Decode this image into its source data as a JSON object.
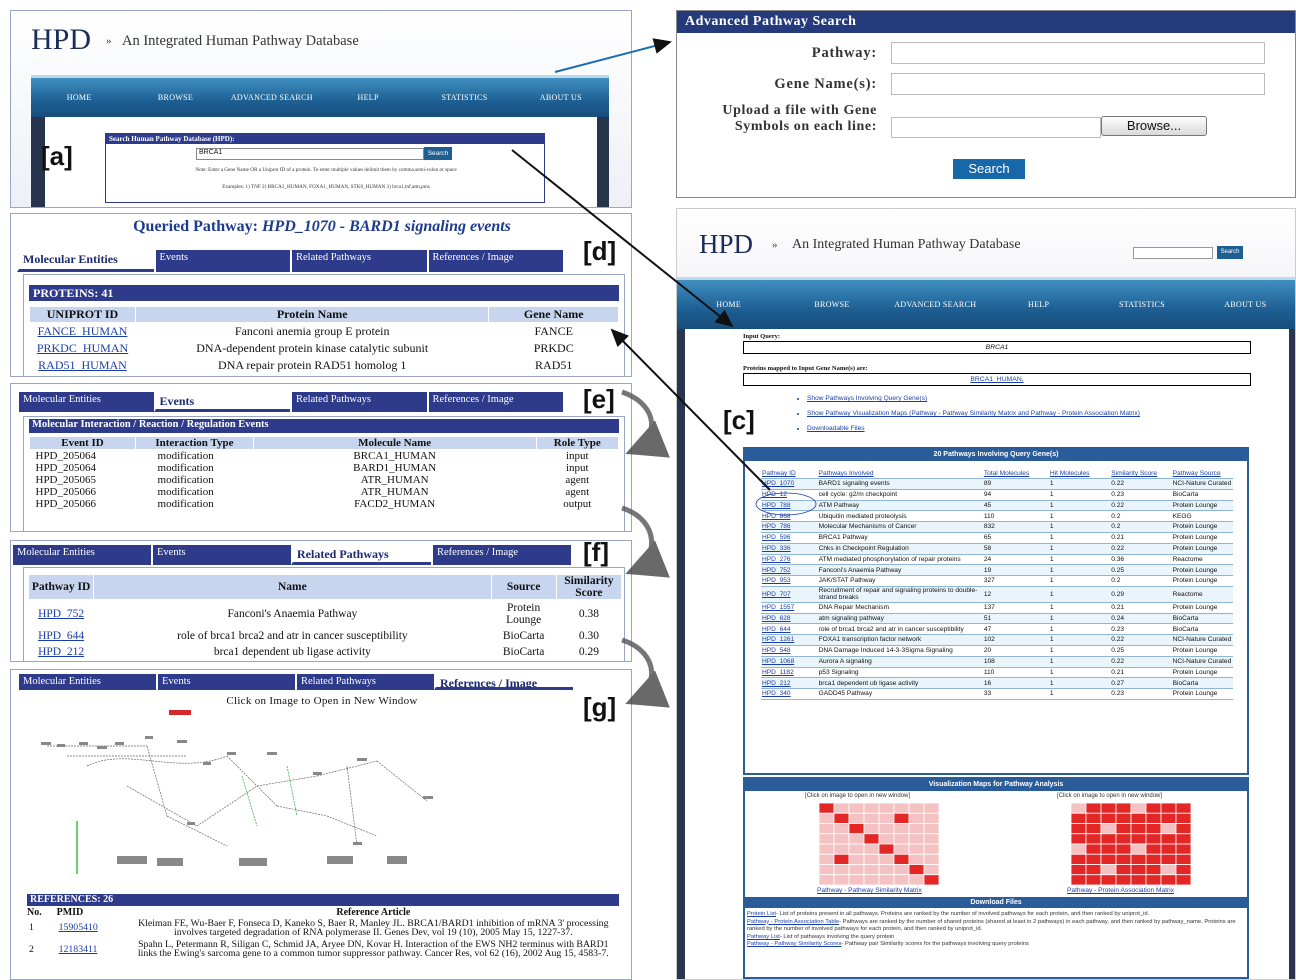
{
  "panel_a": {
    "brand": "HPD",
    "sep": "»",
    "subtitle": "An Integrated Human Pathway Database",
    "nav": [
      "HOME",
      "BROWSE",
      "ADVANCED SEARCH",
      "HELP",
      "STATISTICS",
      "ABOUT US"
    ],
    "search_title": "Search Human Pathway Database (HPD):",
    "search_value": "BRCA1",
    "search_button": "Search",
    "note": "Note: Enter a Gene Name OR a Uniprot ID of a protein. To enter multiple values delimit them by comma,semi-colon or space",
    "examples": "Examples: 1) TNF 2) BRCA1_HUMAN, FOXA1_HUMAN, STK6_HUMAN 3) brca1,tnf,atm,pms"
  },
  "labels": {
    "a": "[a]",
    "c": "[c]",
    "d": "[d]",
    "e": "[e]",
    "f": "[f]",
    "g": "[g]"
  },
  "adv": {
    "title": "Advanced Pathway Search",
    "pathway": "Pathway:",
    "gene": "Gene Name(s):",
    "upload": "Upload a file with Gene Symbols on each line:",
    "browse": "Browse...",
    "search": "Search"
  },
  "tabs": [
    "Molecular Entities",
    "Events",
    "Related Pathways",
    "References / Image"
  ],
  "panel_d": {
    "title_prefix": "Queried Pathway: ",
    "title_id": "HPD_1070 - BARD1 signaling events",
    "proteins": "PROTEINS: 41",
    "headers": [
      "UNIPROT ID",
      "Protein Name",
      "Gene Name"
    ],
    "rows": [
      [
        "FANCE_HUMAN",
        "Fanconi anemia group E protein",
        "FANCE"
      ],
      [
        "PRKDC_HUMAN",
        "DNA-dependent protein kinase catalytic subunit",
        "PRKDC"
      ],
      [
        "RAD51_HUMAN",
        "DNA repair protein RAD51 homolog 1",
        "RAD51"
      ]
    ]
  },
  "panel_e": {
    "bar": "Molecular Interaction / Reaction / Regulation Events",
    "headers": [
      "Event ID",
      "Interaction Type",
      "Molecule Name",
      "Role Type"
    ],
    "rows": [
      [
        "HPD_205064",
        "modification",
        "BRCA1_HUMAN",
        "input"
      ],
      [
        "HPD_205064",
        "modification",
        "BARD1_HUMAN",
        "input"
      ],
      [
        "HPD_205065",
        "modification",
        "ATR_HUMAN",
        "agent"
      ],
      [
        "HPD_205066",
        "modification",
        "ATR_HUMAN",
        "agent"
      ],
      [
        "HPD_205066",
        "modification",
        "FACD2_HUMAN",
        "output"
      ]
    ]
  },
  "panel_f": {
    "headers": [
      "Pathway ID",
      "Name",
      "Source",
      "Similarity Score"
    ],
    "rows": [
      [
        "HPD_752",
        "Fanconi's Anaemia Pathway",
        "Protein Lounge",
        "0.38"
      ],
      [
        "HPD_644",
        "role of brca1 brca2 and atr in cancer susceptibility",
        "BioCarta",
        "0.30"
      ],
      [
        "HPD_212",
        "brca1 dependent ub ligase activity",
        "BioCarta",
        "0.29"
      ]
    ]
  },
  "panel_g": {
    "click": "Click on Image to Open in New Window",
    "refs": "REFERENCES: 26",
    "headers": [
      "No.",
      "PMID",
      "Reference Article"
    ],
    "rows": [
      [
        "1",
        "15905410",
        "Kleiman FE, Wu-Baer F, Fonseca D, Kaneko S, Baer R, Manley JL. BRCA1/BARD1 inhibition of mRNA 3' processing involves targeted degradation of RNA polymerase II. Genes Dev, vol 19 (10), 2005 May 15, 1227-37."
      ],
      [
        "2",
        "12183411",
        "Spahn L, Petermann R, Siligan C, Schmid JA, Aryee DN, Kovar H. Interaction of the EWS NH2 terminus with BARD1 links the Ewing's sarcoma gene to a common tumor suppressor pathway. Cancer Res, vol 62 (16), 2002 Aug 15, 4583-7."
      ]
    ]
  },
  "panel_c": {
    "brand": "HPD",
    "sep": "»",
    "subtitle": "An Integrated Human Pathway Database",
    "search": "Search",
    "nav": [
      "HOME",
      "BROWSE",
      "ADVANCED SEARCH",
      "HELP",
      "STATISTICS",
      "ABOUT US"
    ],
    "input_query_label": "Input Query:",
    "input_query": "BRCA1",
    "mapped_label": "Proteins mapped to Input Gene Name(s) are:",
    "mapped": "BRCA1_HUMAN,",
    "links": [
      "Show Pathways Involving Query Gene(s)",
      "Show Pathway Visualization Maps (Pathway - Pathway Similarity Matrix and Pathway - Protein Association Matrix)",
      "Downloadable Files"
    ],
    "table_title": "20 Pathways Involving Query Gene(s)",
    "headers": [
      "Pathway ID",
      "Pathways Involved",
      "Total Molecules",
      "Hit Molecules",
      "Similarity Score",
      "Pathway Source"
    ],
    "rows": [
      [
        "HPD_1070",
        "BARD1 signaling events",
        "89",
        "1",
        "0.22",
        "NCI-Nature Curated"
      ],
      [
        "HPD_12",
        "cell cycle: g2/m checkpoint",
        "94",
        "1",
        "0.23",
        "BioCarta"
      ],
      [
        "HPD_788",
        "ATM Pathway",
        "45",
        "1",
        "0.22",
        "Protein Lounge"
      ],
      [
        "HPD_868",
        "Ubiquitin mediated proteolysis",
        "110",
        "1",
        "0.2",
        "KEGG"
      ],
      [
        "HPD_786",
        "Molecular Mechanisms of Cancer",
        "832",
        "1",
        "0.2",
        "Protein Lounge"
      ],
      [
        "HPD_596",
        "BRCA1 Pathway",
        "65",
        "1",
        "0.21",
        "Protein Lounge"
      ],
      [
        "HPD_336",
        "Chks in Checkpoint Regulation",
        "58",
        "1",
        "0.22",
        "Protein Lounge"
      ],
      [
        "HPD_276",
        "ATM mediated phosphorylation of repair proteins",
        "24",
        "1",
        "0.36",
        "Reactome"
      ],
      [
        "HPD_752",
        "Fanconi's Anaemia Pathway",
        "19",
        "1",
        "0.25",
        "Protein Lounge"
      ],
      [
        "HPD_953",
        "JAK/STAT Pathway",
        "327",
        "1",
        "0.2",
        "Protein Lounge"
      ],
      [
        "HPD_707",
        "Recruitment of repair and signaling proteins to double-strand breaks",
        "12",
        "1",
        "0.29",
        "Reactome"
      ],
      [
        "HPD_1557",
        "DNA Repair Mechanism",
        "137",
        "1",
        "0.21",
        "Protein Lounge"
      ],
      [
        "HPD_628",
        "atm signaling pathway",
        "51",
        "1",
        "0.24",
        "BioCarta"
      ],
      [
        "HPD_644",
        "role of brca1 brca2 and atr in cancer susceptibility",
        "47",
        "1",
        "0.23",
        "BioCarta"
      ],
      [
        "HPD_1261",
        "FOXA1 transcription factor network",
        "102",
        "1",
        "0.22",
        "NCI-Nature Curated"
      ],
      [
        "HPD_548",
        "DNA Damage Induced 14-3-3Sigma Signaling",
        "20",
        "1",
        "0.25",
        "Protein Lounge"
      ],
      [
        "HPD_1068",
        "Aurora A signaling",
        "108",
        "1",
        "0.22",
        "NCI-Nature Curated"
      ],
      [
        "HPD_1182",
        "p53 Signaling",
        "110",
        "1",
        "0.21",
        "Protein Lounge"
      ],
      [
        "HPD_212",
        "brca1 dependent ub ligase activity",
        "16",
        "1",
        "0.27",
        "BioCarta"
      ],
      [
        "HPD_340",
        "GADD45 Pathway",
        "33",
        "1",
        "0.23",
        "Protein Lounge"
      ]
    ],
    "vis_title": "Visualization Maps for Pathway Analysis",
    "click1": "[Click on image to open in new window]",
    "click2": "[Click on image to open in new window]",
    "map1": "Pathway - Pathway Similarity Matrix",
    "map2": "Pathway - Protein Association Matrix",
    "download_title": "Download Files",
    "downloads": [
      [
        "Protein List",
        "- List of proteins present in all pathways. Proteins are ranked by the number of involved pathways for each protein, and then ranked by uniprot_id."
      ],
      [
        "Pathway - Protein Association Table",
        "- Pathways are ranked by the number of shared proteins (shared at least in 2 pathways) in each pathway, and then ranked by pathway_name. Proteins are ranked by the number of involved pathways for each protein, and then ranked by uniprot_id."
      ],
      [
        "Pathway List",
        "- List of pathways involving the query protein"
      ],
      [
        "Pathway - Pathway Similarity Scores",
        "- Pathway pair Similarity scores for the pathways involving query proteins"
      ]
    ]
  },
  "colors": {
    "navy": "#2e3a8a",
    "nav_blue": "#1e5f93",
    "adv_header": "#253a7a",
    "heat_red": "#e32626",
    "heat_light": "#f4c2c2"
  }
}
